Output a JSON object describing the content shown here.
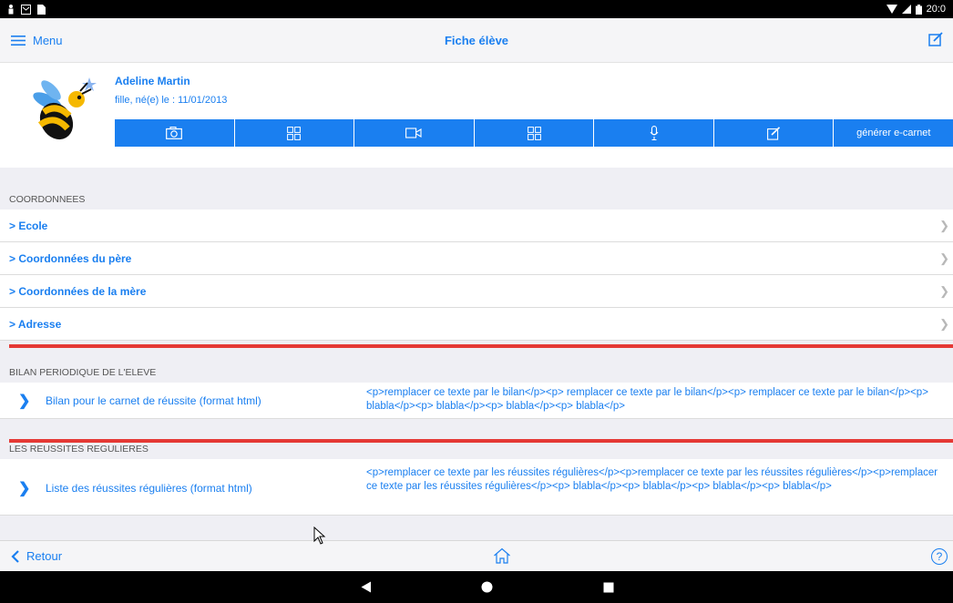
{
  "status_bar": {
    "time": "20:0"
  },
  "nav": {
    "menu_label": "Menu",
    "title": "Fiche élève"
  },
  "student": {
    "name": "Adeline Martin",
    "info": "fille, né(e) le : 11/01/2013"
  },
  "actions": {
    "generate_label": "générer e-carnet"
  },
  "sections": {
    "coordonnees": {
      "header": "COORDONNEES",
      "items": [
        {
          "label": "> Ecole"
        },
        {
          "label": "> Coordonnées du père"
        },
        {
          "label": "> Coordonnées de la mère"
        },
        {
          "label": "> Adresse"
        }
      ]
    },
    "bilan": {
      "header": "BILAN PERIODIQUE DE L'ELEVE",
      "label": "Bilan pour le carnet de réussite (format html)",
      "value": "<p>remplacer ce texte par le bilan</p><p> remplacer ce texte par le bilan</p><p> remplacer ce texte par le bilan</p><p> blabla</p><p> blabla</p><p> blabla</p><p> blabla</p>"
    },
    "reussites": {
      "header": "LES REUSSITES REGULIERES",
      "label": "Liste des réussites régulières (format html)",
      "value": "<p>remplacer ce texte par les réussites régulières</p><p>remplacer ce texte par les réussites régulières</p><p>remplacer ce texte par les réussites régulières</p><p> blabla</p><p> blabla</p><p> blabla</p><p> blabla</p>"
    }
  },
  "bottom": {
    "back_label": "Retour",
    "help_label": "?"
  },
  "colors": {
    "accent": "#1a7ff0",
    "separator": "#e53935",
    "section_bg": "#efeff4"
  }
}
